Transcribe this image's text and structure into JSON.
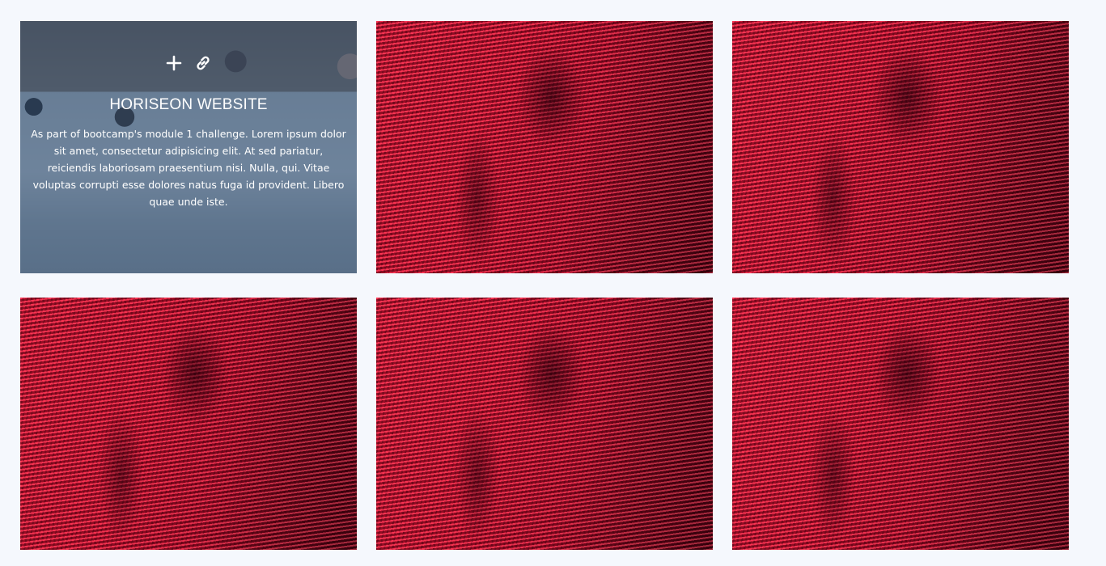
{
  "portfolio": {
    "featured": {
      "title": "HORISEON WEBSITE",
      "description": "As part of bootcamp's module 1 challenge. Lorem ipsum dolor sit amet, consectetur adipisicing elit. At sed pariatur, reiciendis laboriosam praesentium nisi. Nulla, qui. Vitae voluptas corrupti esse dolores natus fuga id provident. Libero quae unde iste.",
      "icons": [
        "plus-icon",
        "link-icon"
      ],
      "image": "team-meeting-photo"
    },
    "tiles": [
      {
        "image": "red-led-wall-photo"
      },
      {
        "image": "red-led-wall-photo"
      },
      {
        "image": "red-led-wall-photo"
      },
      {
        "image": "red-led-wall-photo"
      },
      {
        "image": "red-led-wall-photo"
      }
    ]
  },
  "colors": {
    "page_background": "#f5f8fd",
    "overlay": "#28486e",
    "overlay_text": "#ffffff",
    "led_red": "#f01838"
  }
}
